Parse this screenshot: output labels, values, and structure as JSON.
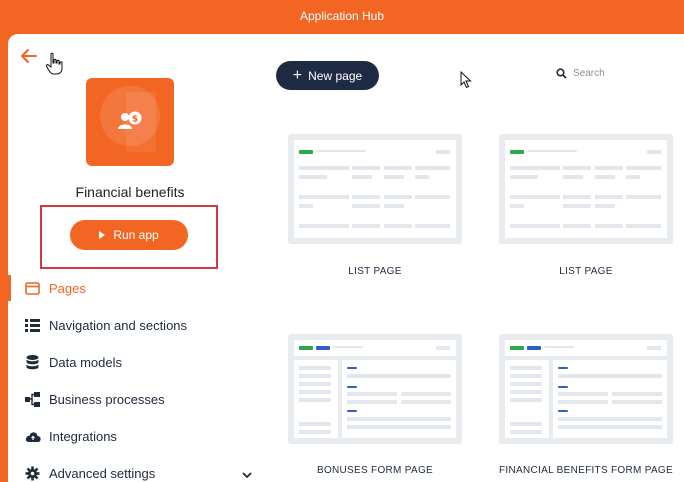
{
  "header": {
    "title": "Application Hub"
  },
  "app": {
    "name": "Financial benefits",
    "run_label": "Run app",
    "accent": "#f26522"
  },
  "sidebar": {
    "items": [
      {
        "label": "Pages",
        "icon": "browser-window-icon",
        "active": true
      },
      {
        "label": "Navigation and sections",
        "icon": "list-icon"
      },
      {
        "label": "Data models",
        "icon": "database-icon"
      },
      {
        "label": "Business processes",
        "icon": "flowchart-icon"
      },
      {
        "label": "Integrations",
        "icon": "cloud-icon"
      },
      {
        "label": "Advanced settings",
        "icon": "gear-icon"
      }
    ]
  },
  "toolbar": {
    "new_page_label": "New page",
    "search_placeholder": "Search"
  },
  "pages": [
    {
      "label": "LIST PAGE",
      "type": "list"
    },
    {
      "label": "LIST PAGE",
      "type": "list"
    },
    {
      "label": "BONUSES FORM PAGE",
      "type": "form"
    },
    {
      "label": "FINANCIAL BENEFITS FORM PAGE",
      "type": "form"
    }
  ]
}
